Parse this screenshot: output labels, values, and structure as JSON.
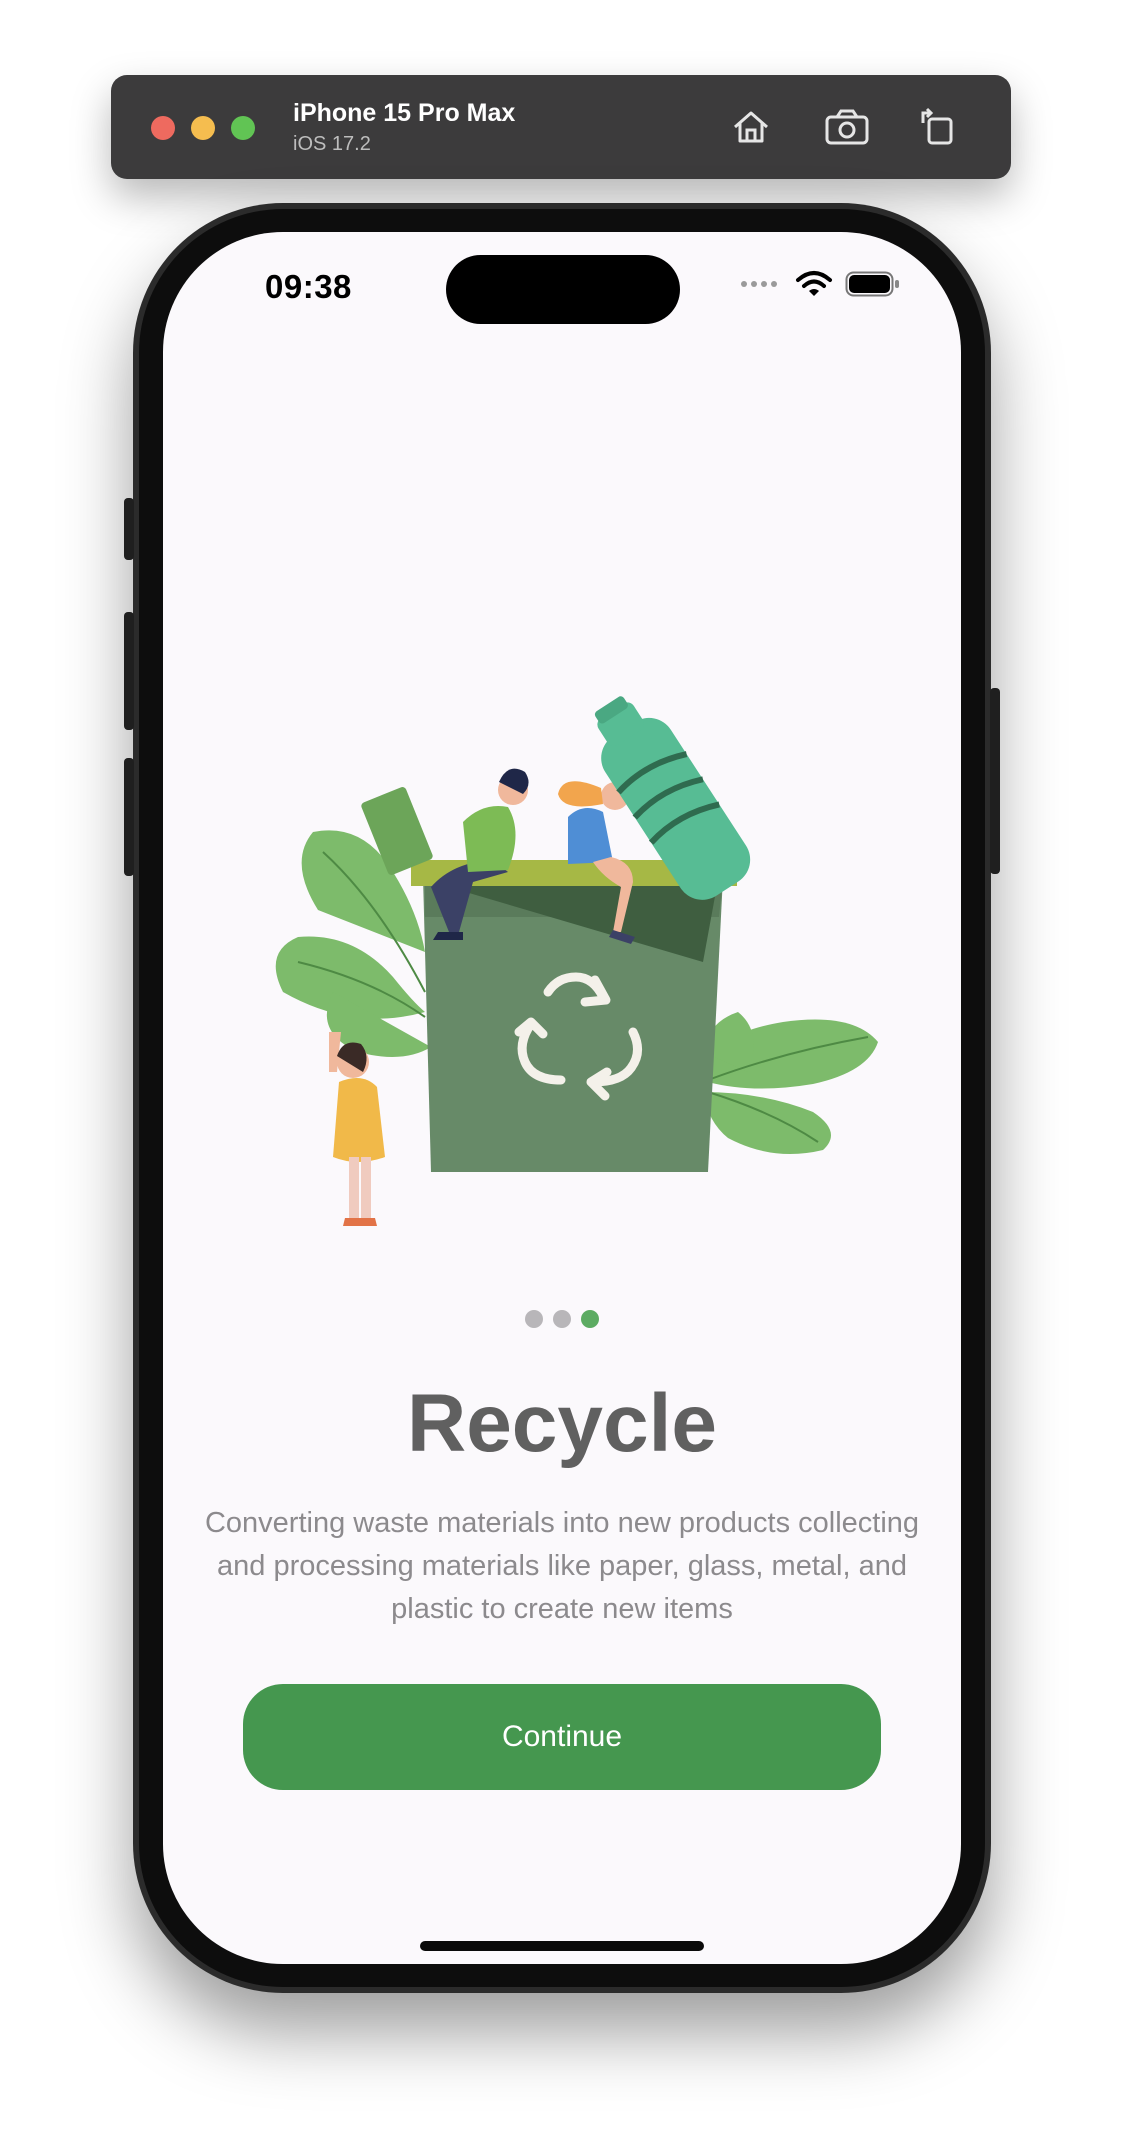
{
  "simulator": {
    "device": "iPhone 15 Pro Max",
    "os": "iOS 17.2",
    "toolbar_icons": [
      "home-icon",
      "screenshot-icon",
      "rotate-icon"
    ]
  },
  "status_bar": {
    "time": "09:38",
    "icons": [
      "signal-dots-icon",
      "wifi-icon",
      "battery-icon"
    ]
  },
  "onboarding": {
    "illustration": "recycle-bin-illustration",
    "page_count": 3,
    "active_page": 3,
    "title": "Recycle",
    "description": "Converting waste materials into new products collecting and processing materials like paper, glass, metal, and plastic to create new items",
    "button_label": "Continue"
  },
  "colors": {
    "accent_green": "#45974f",
    "active_dot": "#5cab62",
    "title": "#606060",
    "body": "#8c8a8d",
    "background": "#fbf9fc"
  }
}
